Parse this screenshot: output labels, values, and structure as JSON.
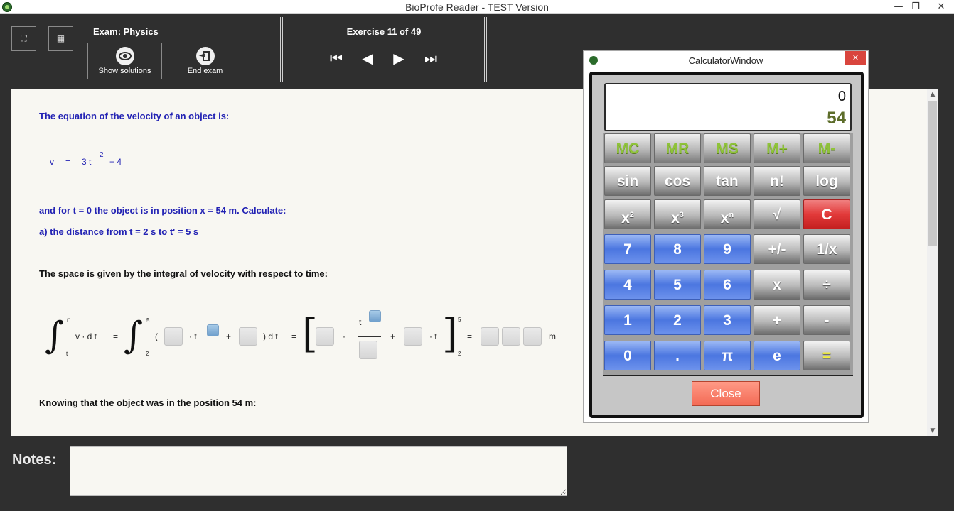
{
  "window": {
    "title": "BioProfe Reader - TEST Version",
    "minimize": "—",
    "maximize": "❐",
    "close": "✕"
  },
  "toolbar": {
    "fullscreen_icon": "⛶",
    "calculator_icon": "▦",
    "exam_label": "Exam:  Physics",
    "show_solutions": "Show solutions",
    "end_exam": "End exam",
    "exercise_label": "Exercise 11 of 49",
    "nav": {
      "first": "⏮",
      "prev": "◀",
      "next": "▶",
      "last": "⏭"
    }
  },
  "content": {
    "intro": "The equation of the velocity of an object is:",
    "eq": {
      "lhs": "v",
      "eq": "=",
      "term": "3 t",
      "exp": "2",
      "rest": "+ 4"
    },
    "condition": "and for t = 0 the object is in position x = 54 m. Calculate:",
    "question_a": "a) the distance from t = 2 s  to  t' = 5 s",
    "space_text": "The space is given by the integral of velocity with respect to time:",
    "integral": {
      "upper1": "t'",
      "lower1": "t",
      "integrand": "v · d t",
      "eq1": "=",
      "upper2": "5",
      "lower2": "2",
      "lparen": "(",
      "dot1": "· t",
      "plus1": "+",
      "rparen": ") d t",
      "eq2": "=",
      "dot2": "·",
      "t_num": "t",
      "plus2": "+",
      "dot3": "· t",
      "upper3": "5",
      "lower3": "2",
      "eq3": "=",
      "unit": "m",
      "lbracket": "[",
      "rbracket": "]"
    },
    "knowing": "Knowing that the object was in the position  54 m:"
  },
  "scroll": {
    "up": "▲",
    "down": "▼"
  },
  "notes": {
    "label": "Notes:",
    "value": ""
  },
  "calculator": {
    "title": "CalculatorWindow",
    "close_icon": "✕",
    "display_top": "0",
    "display_bottom": "54",
    "rows": [
      [
        "MC",
        "MR",
        "MS",
        "M+",
        "M-"
      ],
      [
        "sin",
        "cos",
        "tan",
        "n!",
        "log"
      ],
      [
        "x",
        "x",
        "x",
        "√",
        "C"
      ],
      [
        "7",
        "8",
        "9",
        "+/-",
        "1/x"
      ],
      [
        "4",
        "5",
        "6",
        "x",
        "÷"
      ],
      [
        "1",
        "2",
        "3",
        "+",
        "-"
      ],
      [
        "0",
        ".",
        "π",
        "e",
        "="
      ]
    ],
    "powers": [
      "2",
      "3",
      "n"
    ],
    "close_label": "Close"
  }
}
